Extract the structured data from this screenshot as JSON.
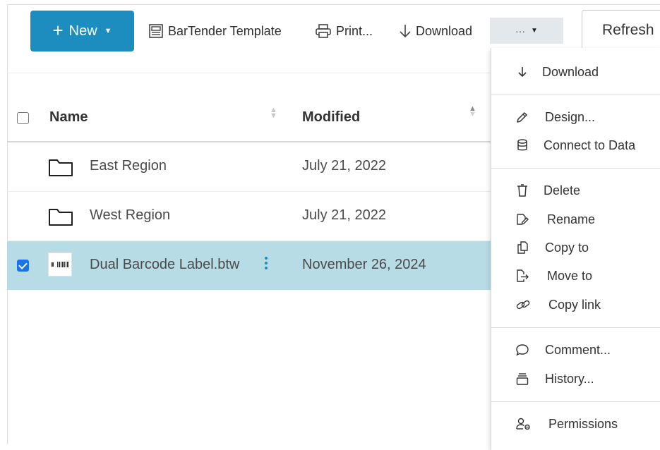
{
  "toolbar": {
    "new_label": "New",
    "bartender_template_label": "BarTender Template",
    "print_label": "Print...",
    "download_label": "Download",
    "more_label": "···",
    "refresh_label": "Refresh"
  },
  "table": {
    "columns": {
      "name": "Name",
      "modified": "Modified"
    },
    "rows": [
      {
        "name": "East Region",
        "modified": "July 21, 2022",
        "type": "folder",
        "selected": false
      },
      {
        "name": "West Region",
        "modified": "July 21, 2022",
        "type": "folder",
        "selected": false
      },
      {
        "name": "Dual Barcode Label.btw",
        "modified": "November 26, 2024",
        "type": "btw-file",
        "selected": true
      }
    ]
  },
  "menu": {
    "items": [
      {
        "label": "Download",
        "icon": "download-icon"
      },
      {
        "label": "Design...",
        "icon": "pencil-icon"
      },
      {
        "label": "Connect to Data",
        "icon": "database-icon"
      },
      {
        "label": "Delete",
        "icon": "trash-icon"
      },
      {
        "label": "Rename",
        "icon": "rename-icon"
      },
      {
        "label": "Copy to",
        "icon": "copy-icon"
      },
      {
        "label": "Move to",
        "icon": "move-icon"
      },
      {
        "label": "Copy link",
        "icon": "link-icon"
      },
      {
        "label": "Comment...",
        "icon": "comment-icon"
      },
      {
        "label": "History...",
        "icon": "history-icon"
      },
      {
        "label": "Permissions",
        "icon": "permissions-icon"
      }
    ]
  },
  "colors": {
    "accent": "#1d8dc0",
    "selected_row": "#b7dce6",
    "more_button_bg": "#e3e8ec"
  }
}
